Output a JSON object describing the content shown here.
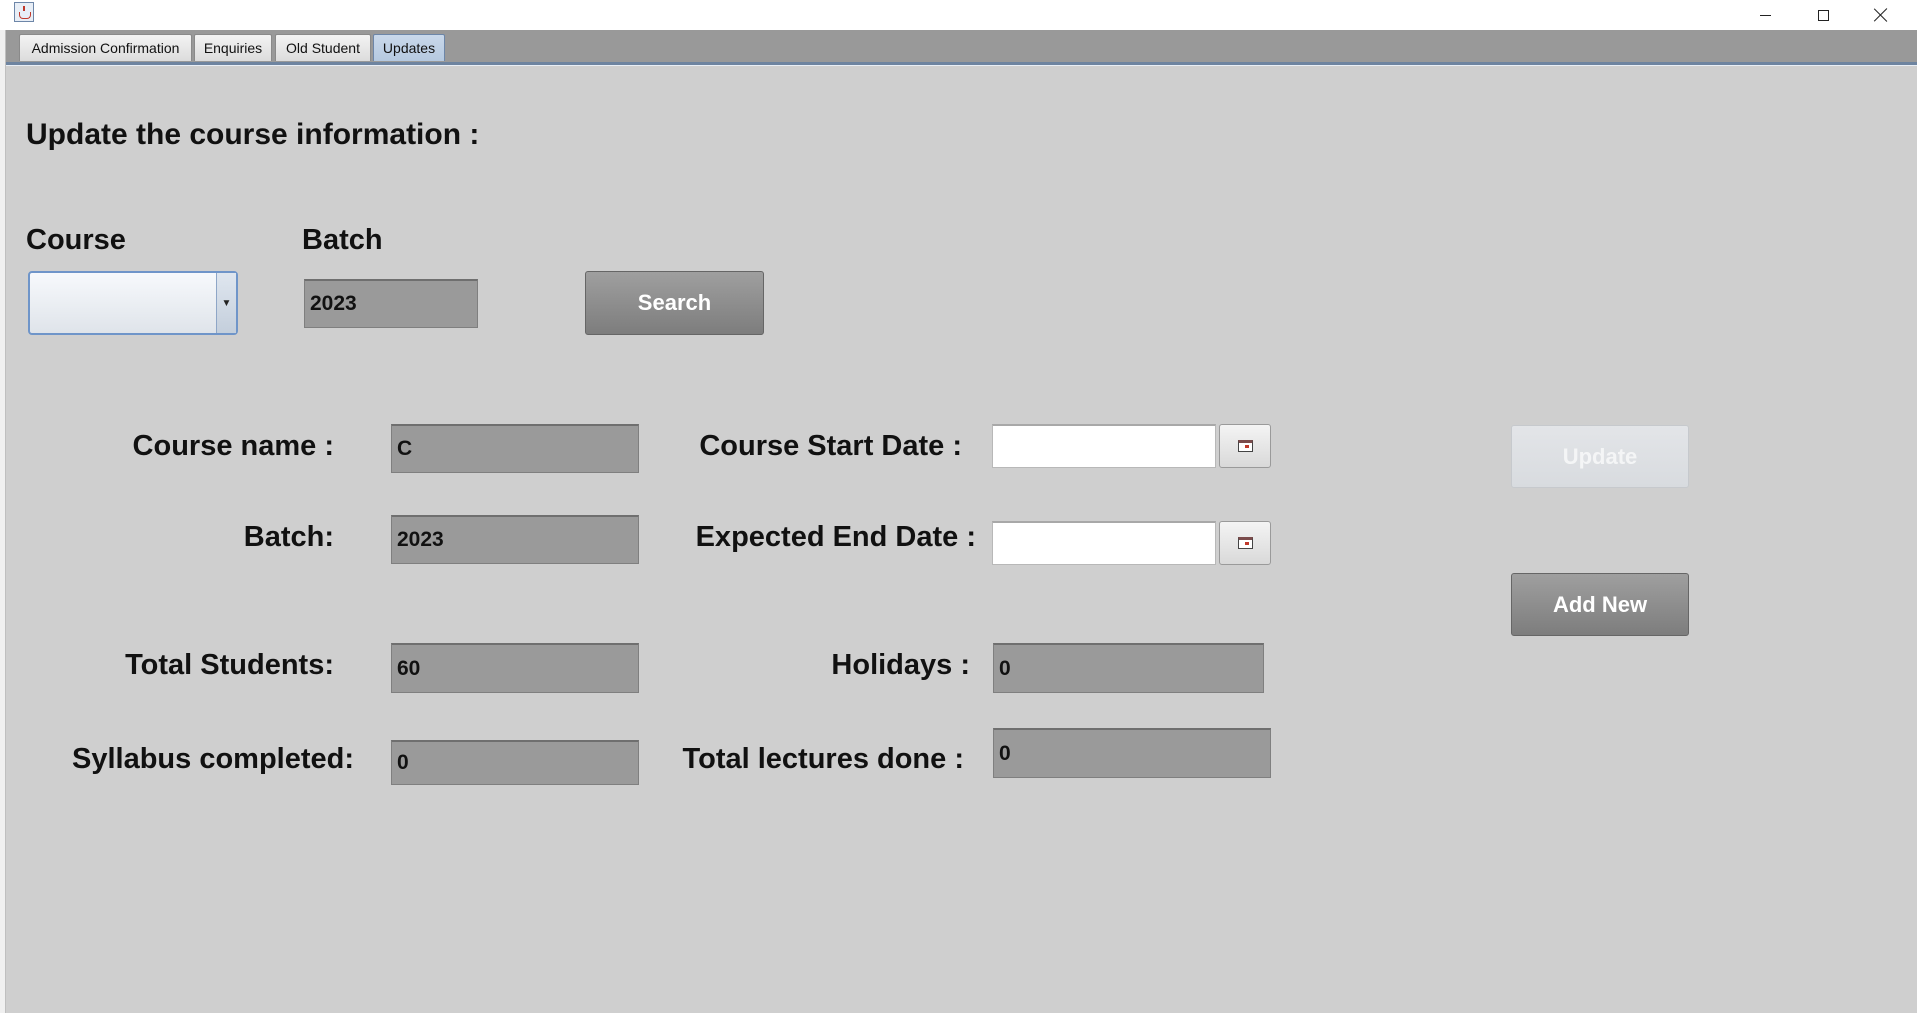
{
  "window": {
    "icon": "java-coffee-icon",
    "controls": {
      "minimize": "minimize-icon",
      "maximize": "maximize-icon",
      "close": "close-icon"
    }
  },
  "tabs": [
    {
      "label": "Admission Confirmation",
      "active": false
    },
    {
      "label": "Enquiries",
      "active": false
    },
    {
      "label": "Old Student",
      "active": false
    },
    {
      "label": "Updates",
      "active": true
    }
  ],
  "main": {
    "heading": "Update the course information :",
    "search_row": {
      "course_label": "Course",
      "course_value": "",
      "batch_label": "Batch",
      "batch_value": "2023",
      "search_button": "Search"
    },
    "form": {
      "course_name_label": "Course name :",
      "course_name_value": "C",
      "batch_label": "Batch:",
      "batch_value": "2023",
      "total_students_label": "Total Students:",
      "total_students_value": "60",
      "syllabus_label": "Syllabus completed:",
      "syllabus_value": "0",
      "start_date_label": "Course Start Date :",
      "start_date_value": "",
      "end_date_label": "Expected End Date :",
      "end_date_value": "",
      "holidays_label": "Holidays :",
      "holidays_value": "0",
      "lectures_label": "Total lectures done :",
      "lectures_value": "0"
    },
    "buttons": {
      "update": "Update",
      "update_enabled": false,
      "add_new": "Add New"
    }
  },
  "colors": {
    "background": "#cfcfcf",
    "field": "#9a9a9a",
    "button": "#8c8c8c",
    "tab_active": "#b5c9e0"
  }
}
